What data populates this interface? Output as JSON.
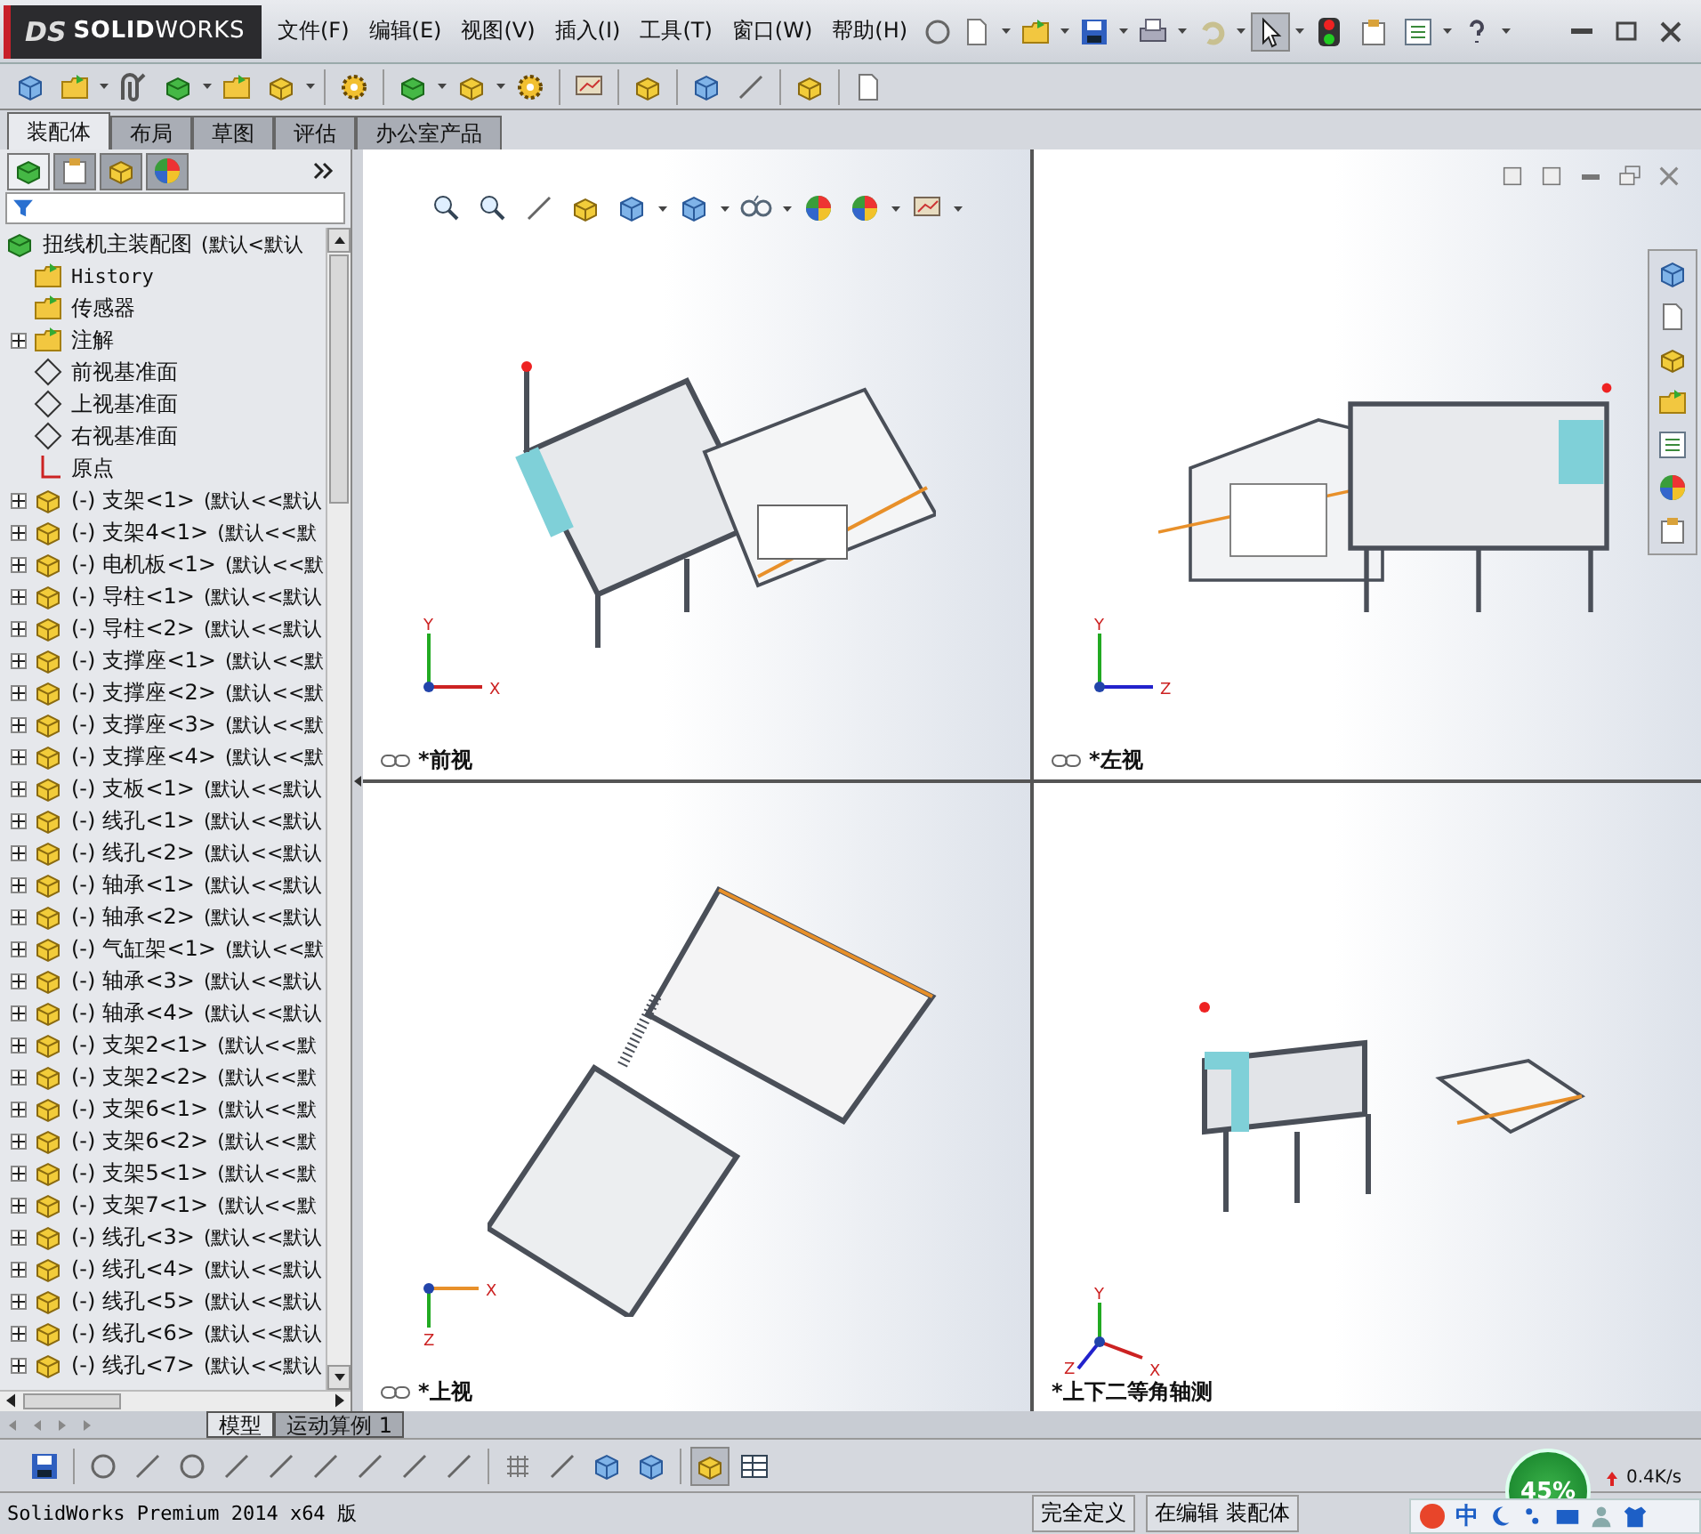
{
  "app": {
    "logo_mark": "DS",
    "logo_text": "**SOLID**WORKS"
  },
  "menu": [
    "文件(F)",
    "编辑(E)",
    "视图(V)",
    "插入(I)",
    "工具(T)",
    "窗口(W)",
    "帮助(H)"
  ],
  "command_tabs": [
    {
      "label": "装配体",
      "selected": true
    },
    {
      "label": "布局",
      "selected": false
    },
    {
      "label": "草图",
      "selected": false
    },
    {
      "label": "评估",
      "selected": false
    },
    {
      "label": "办公室产品",
      "selected": false
    }
  ],
  "feature_tree": {
    "root": {
      "name": "扭线机主装配图",
      "config": "(默认<默认"
    },
    "items": [
      {
        "kind": "history",
        "name": "History",
        "expandable": false
      },
      {
        "kind": "sensors",
        "name": "传感器",
        "expandable": false
      },
      {
        "kind": "annotations",
        "name": "注解",
        "expandable": true
      },
      {
        "kind": "plane",
        "name": "前视基准面",
        "expandable": false
      },
      {
        "kind": "plane",
        "name": "上视基准面",
        "expandable": false
      },
      {
        "kind": "plane",
        "name": "右视基准面",
        "expandable": false
      },
      {
        "kind": "origin",
        "name": "原点",
        "expandable": false
      },
      {
        "kind": "part",
        "state": "(-)",
        "name": "支架<1>",
        "config": "(默认<<默认",
        "expandable": true
      },
      {
        "kind": "part",
        "state": "(-)",
        "name": "支架4<1>",
        "config": "(默认<<默",
        "expandable": true
      },
      {
        "kind": "part",
        "state": "(-)",
        "name": "电机板<1>",
        "config": "(默认<<默",
        "expandable": true
      },
      {
        "kind": "part",
        "state": "(-)",
        "name": "导柱<1>",
        "config": "(默认<<默认",
        "expandable": true
      },
      {
        "kind": "part",
        "state": "(-)",
        "name": "导柱<2>",
        "config": "(默认<<默认",
        "expandable": true
      },
      {
        "kind": "part",
        "state": "(-)",
        "name": "支撑座<1>",
        "config": "(默认<<默",
        "expandable": true
      },
      {
        "kind": "part",
        "state": "(-)",
        "name": "支撑座<2>",
        "config": "(默认<<默",
        "expandable": true
      },
      {
        "kind": "part",
        "state": "(-)",
        "name": "支撑座<3>",
        "config": "(默认<<默",
        "expandable": true
      },
      {
        "kind": "part",
        "state": "(-)",
        "name": "支撑座<4>",
        "config": "(默认<<默",
        "expandable": true
      },
      {
        "kind": "part",
        "state": "(-)",
        "name": "支板<1>",
        "config": "(默认<<默认",
        "expandable": true
      },
      {
        "kind": "part",
        "state": "(-)",
        "name": "线孔<1>",
        "config": "(默认<<默认",
        "expandable": true
      },
      {
        "kind": "part",
        "state": "(-)",
        "name": "线孔<2>",
        "config": "(默认<<默认",
        "expandable": true
      },
      {
        "kind": "part",
        "state": "(-)",
        "name": "轴承<1>",
        "config": "(默认<<默认",
        "expandable": true
      },
      {
        "kind": "part",
        "state": "(-)",
        "name": "轴承<2>",
        "config": "(默认<<默认",
        "expandable": true
      },
      {
        "kind": "part",
        "state": "(-)",
        "name": "气缸架<1>",
        "config": "(默认<<默",
        "expandable": true
      },
      {
        "kind": "part",
        "state": "(-)",
        "name": "轴承<3>",
        "config": "(默认<<默认",
        "expandable": true
      },
      {
        "kind": "part",
        "state": "(-)",
        "name": "轴承<4>",
        "config": "(默认<<默认",
        "expandable": true
      },
      {
        "kind": "part",
        "state": "(-)",
        "name": "支架2<1>",
        "config": "(默认<<默",
        "expandable": true
      },
      {
        "kind": "part",
        "state": "(-)",
        "name": "支架2<2>",
        "config": "(默认<<默",
        "expandable": true
      },
      {
        "kind": "part",
        "state": "(-)",
        "name": "支架6<1>",
        "config": "(默认<<默",
        "expandable": true
      },
      {
        "kind": "part",
        "state": "(-)",
        "name": "支架6<2>",
        "config": "(默认<<默",
        "expandable": true
      },
      {
        "kind": "part",
        "state": "(-)",
        "name": "支架5<1>",
        "config": "(默认<<默",
        "expandable": true
      },
      {
        "kind": "part",
        "state": "(-)",
        "name": "支架7<1>",
        "config": "(默认<<默",
        "expandable": true
      },
      {
        "kind": "part",
        "state": "(-)",
        "name": "线孔<3>",
        "config": "(默认<<默认",
        "expandable": true
      },
      {
        "kind": "part",
        "state": "(-)",
        "name": "线孔<4>",
        "config": "(默认<<默认",
        "expandable": true
      },
      {
        "kind": "part",
        "state": "(-)",
        "name": "线孔<5>",
        "config": "(默认<<默认",
        "expandable": true
      },
      {
        "kind": "part",
        "state": "(-)",
        "name": "线孔<6>",
        "config": "(默认<<默认",
        "expandable": true
      },
      {
        "kind": "part",
        "state": "(-)",
        "name": "线孔<7>",
        "config": "(默认<<默认",
        "expandable": true
      }
    ]
  },
  "viewports": [
    {
      "kind": "front",
      "label": "*前视",
      "link_icon": true,
      "axes": [
        "Y",
        "X"
      ]
    },
    {
      "kind": "left",
      "label": "*左视",
      "link_icon": true,
      "axes": [
        "Y",
        "Z"
      ]
    },
    {
      "kind": "top",
      "label": "*上视",
      "link_icon": true,
      "axes": [
        "X",
        "Z"
      ]
    },
    {
      "kind": "iso",
      "label": "*上下二等角轴测",
      "link_icon": false,
      "axes": [
        "Y",
        "Z",
        "X"
      ]
    }
  ],
  "sheet_tabs": [
    {
      "label": "模型",
      "selected": true
    },
    {
      "label": "运动算例 1",
      "selected": false
    }
  ],
  "status_bar": {
    "product": "SolidWorks Premium 2014 x64 版",
    "fields": [
      "完全定义",
      "在编辑 装配体"
    ]
  },
  "tray": {
    "memory": "45%",
    "network": "0.4K/s",
    "ime": "中"
  }
}
